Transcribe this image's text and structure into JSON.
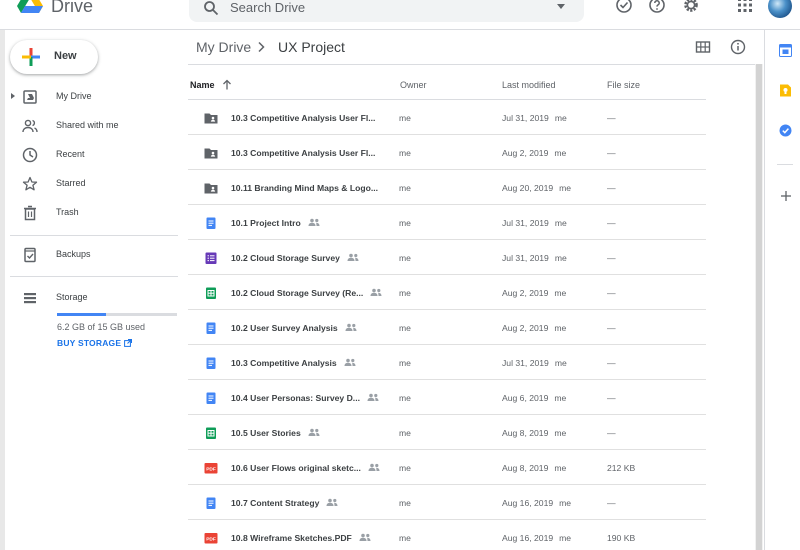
{
  "app": {
    "name": "Drive"
  },
  "search": {
    "placeholder": "Search Drive"
  },
  "header_icons": [
    "offline-check-icon",
    "help-icon",
    "settings-icon",
    "apps-grid-icon",
    "account-avatar"
  ],
  "sidebar": {
    "new_label": "New",
    "items": [
      {
        "label": "My Drive",
        "icon": "my-drive-icon"
      },
      {
        "label": "Shared with me",
        "icon": "people-icon"
      },
      {
        "label": "Recent",
        "icon": "clock-icon"
      },
      {
        "label": "Starred",
        "icon": "star-icon"
      },
      {
        "label": "Trash",
        "icon": "trash-icon"
      },
      {
        "label": "Backups",
        "icon": "backup-icon"
      },
      {
        "label": "Storage",
        "icon": "storage-icon"
      }
    ],
    "storage": {
      "used_text": "6.2 GB of 15 GB used",
      "used_fraction": 0.41,
      "buy_label": "BUY STORAGE"
    }
  },
  "breadcrumb": {
    "root": "My Drive",
    "current": "UX Project"
  },
  "columns": {
    "name": "Name",
    "owner": "Owner",
    "modified": "Last modified",
    "size": "File size"
  },
  "files": [
    {
      "name": "10.3 Competitive Analysis User Fl...",
      "type": "shared-folder",
      "shared": false,
      "owner": "me",
      "modified": "Jul 31, 2019",
      "modified_by": "me",
      "size": "—"
    },
    {
      "name": "10.3 Competitive Analysis User Fl...",
      "type": "shared-folder",
      "shared": false,
      "owner": "me",
      "modified": "Aug 2, 2019",
      "modified_by": "me",
      "size": "—"
    },
    {
      "name": "10.11 Branding Mind Maps & Logo...",
      "type": "shared-folder",
      "shared": false,
      "owner": "me",
      "modified": "Aug 20, 2019",
      "modified_by": "me",
      "size": "—"
    },
    {
      "name": "10.1 Project Intro",
      "type": "doc",
      "shared": true,
      "owner": "me",
      "modified": "Jul 31, 2019",
      "modified_by": "me",
      "size": "—"
    },
    {
      "name": "10.2 Cloud Storage Survey",
      "type": "form",
      "shared": true,
      "owner": "me",
      "modified": "Jul 31, 2019",
      "modified_by": "me",
      "size": "—"
    },
    {
      "name": "10.2 Cloud Storage Survey (Re...",
      "type": "sheet",
      "shared": true,
      "owner": "me",
      "modified": "Aug 2, 2019",
      "modified_by": "me",
      "size": "—"
    },
    {
      "name": "10.2 User Survey Analysis",
      "type": "doc",
      "shared": true,
      "owner": "me",
      "modified": "Aug 2, 2019",
      "modified_by": "me",
      "size": "—"
    },
    {
      "name": "10.3 Competitive Analysis",
      "type": "doc",
      "shared": true,
      "owner": "me",
      "modified": "Jul 31, 2019",
      "modified_by": "me",
      "size": "—"
    },
    {
      "name": "10.4 User Personas: Survey D...",
      "type": "doc",
      "shared": true,
      "owner": "me",
      "modified": "Aug 6, 2019",
      "modified_by": "me",
      "size": "—"
    },
    {
      "name": "10.5 User Stories",
      "type": "sheet",
      "shared": true,
      "owner": "me",
      "modified": "Aug 8, 2019",
      "modified_by": "me",
      "size": "—"
    },
    {
      "name": "10.6 User Flows original sketc...",
      "type": "pdf",
      "shared": true,
      "owner": "me",
      "modified": "Aug 8, 2019",
      "modified_by": "me",
      "size": "212 KB"
    },
    {
      "name": "10.7 Content Strategy",
      "type": "doc",
      "shared": true,
      "owner": "me",
      "modified": "Aug 16, 2019",
      "modified_by": "me",
      "size": "—"
    },
    {
      "name": "10.8 Wireframe Sketches.PDF",
      "type": "pdf",
      "shared": true,
      "owner": "me",
      "modified": "Aug 16, 2019",
      "modified_by": "me",
      "size": "190 KB"
    }
  ],
  "side_panel": [
    "calendar-icon",
    "keep-icon",
    "tasks-icon",
    "add-addon-icon"
  ],
  "colors": {
    "accent": "#1a73e8",
    "doc": "#4285f4",
    "sheet": "#0f9d58",
    "form": "#673ab7",
    "pdf": "#ea4335",
    "folder": "#5f6368"
  }
}
